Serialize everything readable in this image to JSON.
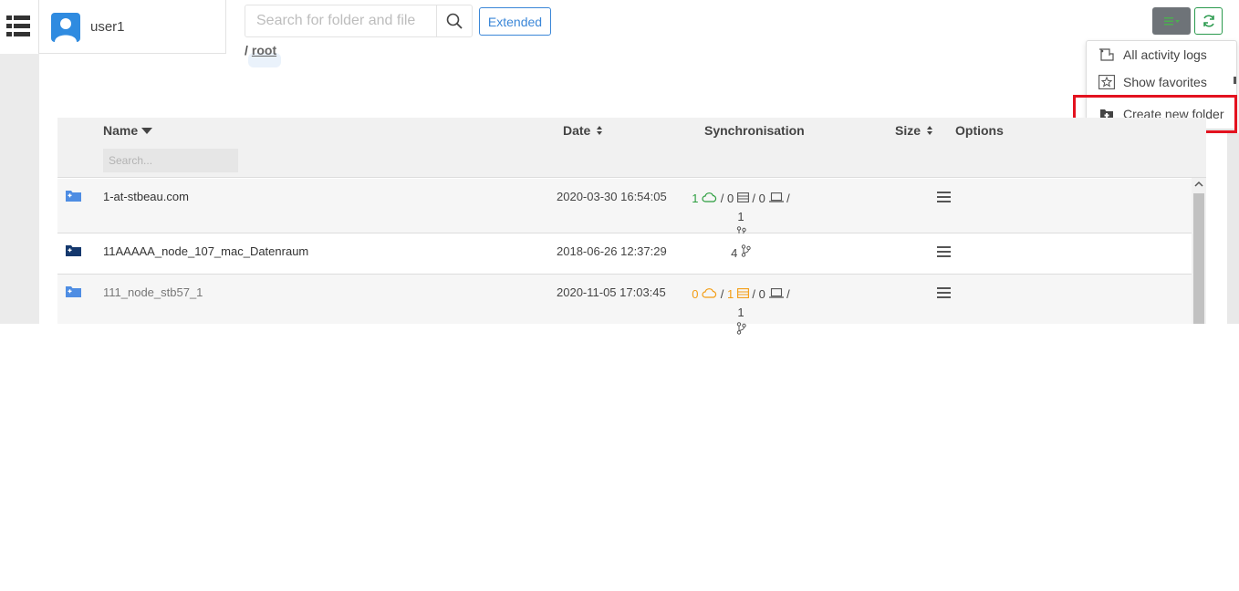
{
  "app": {
    "user": {
      "name": "user1"
    }
  },
  "search": {
    "placeholder": "Search for folder and file",
    "extended_label": "Extended"
  },
  "breadcrumb": {
    "separator": "/",
    "current": "root"
  },
  "dropdown": {
    "items": [
      {
        "label": "All activity logs",
        "icon": "activity-log-icon"
      },
      {
        "label": "Show favorites",
        "icon": "star-icon"
      },
      {
        "label": "Create new folder",
        "icon": "folder-plus-icon"
      }
    ],
    "highlight_color": "#e3121f"
  },
  "table": {
    "headers": {
      "name": "Name",
      "date": "Date",
      "sync": "Synchronisation",
      "size": "Size",
      "options": "Options"
    },
    "name_filter_placeholder": "Search...",
    "rows": [
      {
        "name": "1-at-stbeau.com",
        "date": "2020-03-30 16:54:05",
        "sync": {
          "cloud": "1",
          "server": "0",
          "laptop": "0",
          "branches": "1"
        },
        "sync_color": "#2a9d3d",
        "folder_color": "#4e8de3"
      },
      {
        "name": "11AAAAA_node_107_mac_Datenraum",
        "date": "2018-06-26 12:37:29",
        "sync_text": "4",
        "folder_color": "#14386d"
      },
      {
        "name": "111_node_stb57_1",
        "date": "2020-11-05 17:03:45",
        "sync": {
          "cloud": "0",
          "server": "1",
          "laptop": "0",
          "branches": "1"
        },
        "sync_color": "#f39c12",
        "folder_color": "#4e8de3"
      }
    ]
  },
  "colors": {
    "accent": "#3b87d8",
    "success": "#2b9a4e",
    "menu_button": "#6e7378"
  }
}
